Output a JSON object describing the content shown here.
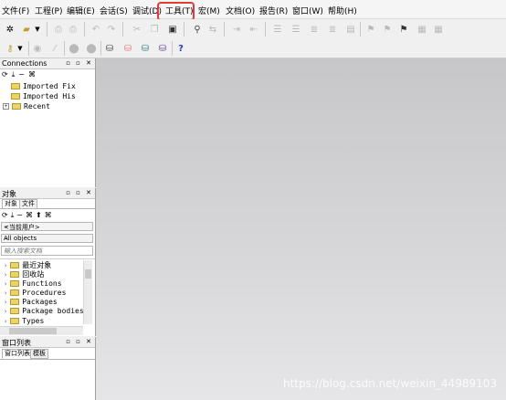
{
  "menubar": {
    "items": [
      "文件(F)",
      "工程(P)",
      "编辑(E)",
      "会话(S)",
      "调试(D)",
      "工具(T)",
      "宏(M)",
      "文档(O)",
      "报告(R)",
      "窗口(W)",
      "帮助(H)"
    ],
    "highlighted": "工具(T)",
    "highlight_color": "#e53935"
  },
  "toolbar1": {
    "icons": [
      "new-icon",
      "open-icon",
      "dropdown-icon",
      "print-icon",
      "print-preview-icon",
      "undo-icon",
      "redo-icon",
      "cut-icon",
      "copy-icon",
      "paste-icon",
      "find-icon",
      "replace-icon",
      "indent-icon",
      "outdent-icon",
      "comment-icon",
      "uncomment-icon",
      "uppercase-icon",
      "lowercase-icon",
      "execute-icon",
      "commit-icon",
      "rollback-icon",
      "explain-icon",
      "format-icon"
    ]
  },
  "toolbar2": {
    "icons": [
      "key-icon",
      "dropdown-icon",
      "connect-icon",
      "disconnect-icon",
      "session-icon",
      "session2-icon",
      "db-new-icon",
      "db-color-icon",
      "db-multicolor-icon",
      "help-icon"
    ],
    "help_label": "?"
  },
  "connections": {
    "title": "Connections",
    "toolbar_glyphs": [
      "⟳",
      "⤓",
      "−",
      "⌘"
    ],
    "items": [
      {
        "label": "Imported Fix",
        "expandable": false
      },
      {
        "label": "Imported His",
        "expandable": false
      },
      {
        "label": "Recent",
        "expandable": true
      }
    ]
  },
  "objects": {
    "title": "对象",
    "tabs": [
      "对象",
      "文件"
    ],
    "toolbar_glyphs": [
      "⟳",
      "⤓",
      "−",
      "⌘",
      "⬆",
      "⌘"
    ],
    "user_combo": "<当前用户>",
    "type_combo": "All objects",
    "search_placeholder": "输入搜索文档",
    "items": [
      "最近对象",
      "回收站",
      "Functions",
      "Procedures",
      "Packages",
      "Package bodies",
      "Types"
    ]
  },
  "windows_list": {
    "title": "窗口列表",
    "tabs": [
      "窗口列表",
      "模板"
    ]
  },
  "panel_buttons": "▫ ▫ ✕",
  "watermark": "https://blog.csdn.net/weixin_44989103",
  "colors": {
    "workspace_top": "#c7c7c9",
    "workspace_bottom": "#e6e6e8",
    "folder": "#e9d36a"
  }
}
